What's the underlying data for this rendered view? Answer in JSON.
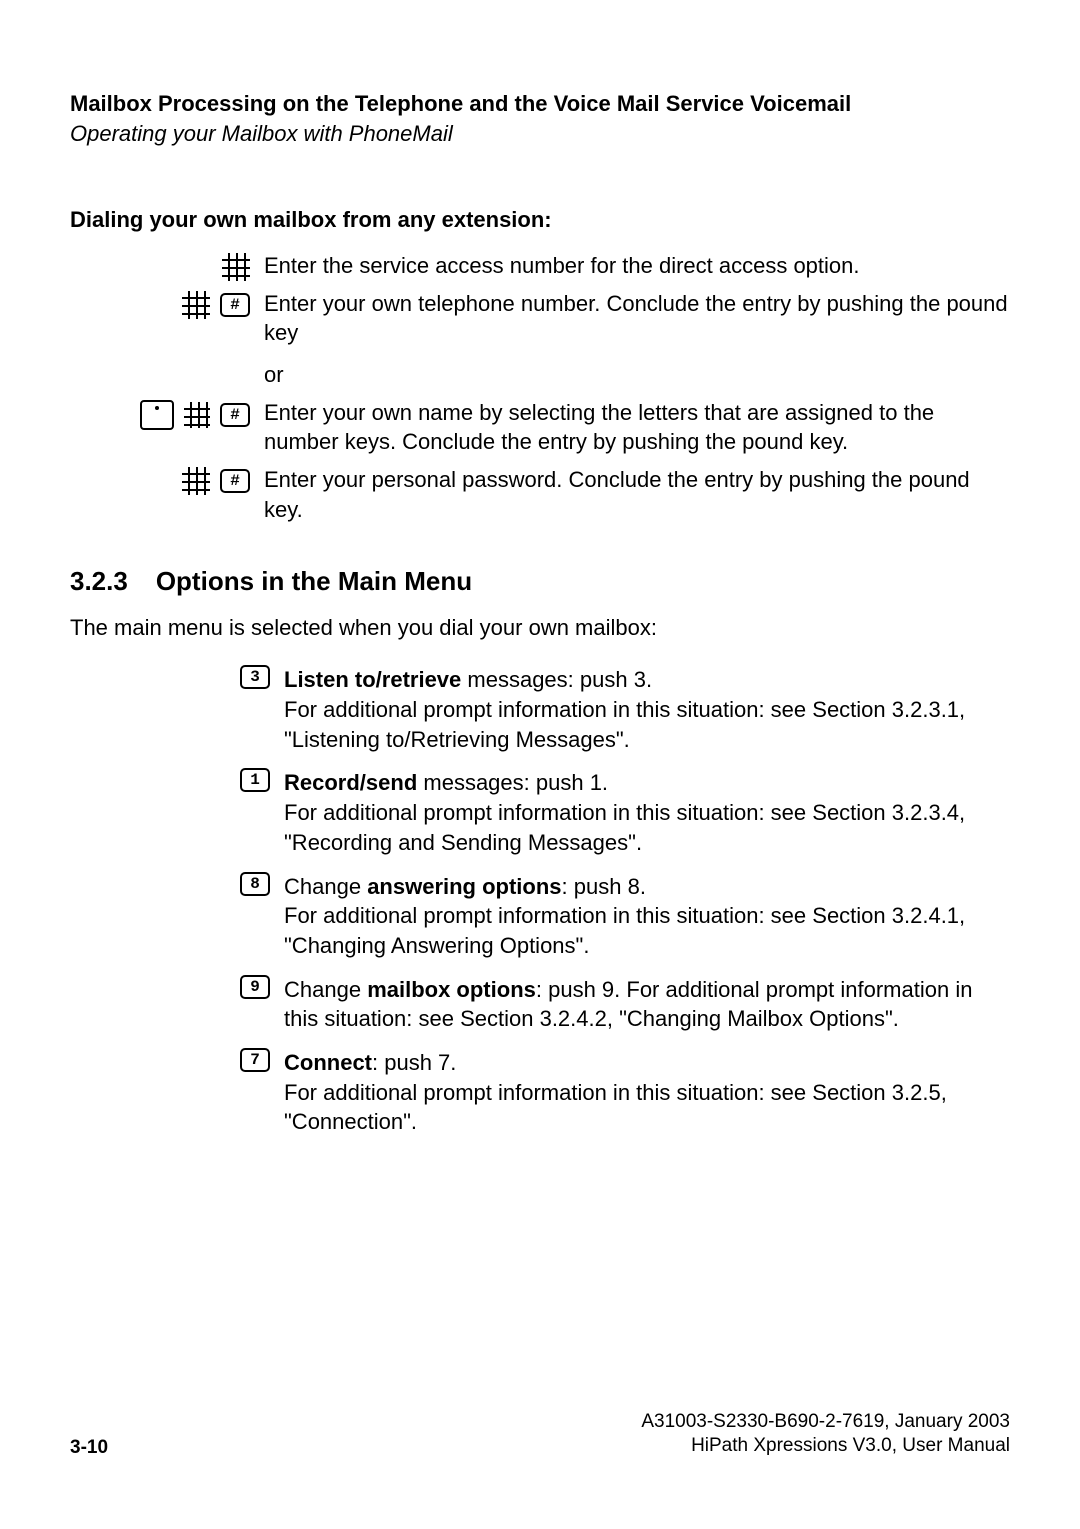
{
  "header": {
    "title": "Mailbox Processing on the Telephone and the Voice Mail Service Voicemail",
    "subtitle": "Operating your Mailbox with PhoneMail"
  },
  "dialing": {
    "heading": "Dialing your own mailbox from any extension:",
    "step1": "Enter the service access number for the direct access option.",
    "step2": "Enter your own telephone number. Conclude the entry by pushing the pound key",
    "or": "or",
    "step3": "Enter your own name by selecting the letters that are assigned to the number keys. Conclude the entry by pushing the pound key.",
    "step4": "Enter your personal password. Conclude the entry by pushing the pound key."
  },
  "section": {
    "number": "3.2.3",
    "title": "Options in the Main Menu",
    "intro": "The main menu is selected when you dial your own mailbox:"
  },
  "options": {
    "o3": {
      "key": "3",
      "b": "Listen to/retrieve",
      "rest": " messages: push 3.",
      "line2": "For additional prompt information in this situation: see Section 3.2.3.1, \"Listening to/Retrieving Messages\"."
    },
    "o1": {
      "key": "1",
      "b": "Record/send",
      "rest": " messages: push 1.",
      "line2": "For additional prompt information in this situation: see Section 3.2.3.4, \"Recording and Sending Messages\"."
    },
    "o8": {
      "key": "8",
      "pre": "Change ",
      "b": "answering options",
      "rest": ": push 8.",
      "line2": "For additional prompt information in this situation: see Section 3.2.4.1, \"Changing Answering Options\"."
    },
    "o9": {
      "key": "9",
      "pre": "Change ",
      "b": "mailbox options",
      "rest": ": push 9. For additional prompt information in this situation: see Section 3.2.4.2, \"Changing Mailbox Options\"."
    },
    "o7": {
      "key": "7",
      "b": "Connect",
      "rest": ": push 7.",
      "line2": "For additional prompt information in this situation: see Section 3.2.5, \"Connection\"."
    }
  },
  "footer": {
    "page": "3-10",
    "doc": "A31003-S2330-B690-2-7619, January 2003",
    "product": "HiPath Xpressions V3.0, User Manual"
  },
  "glyph": {
    "pound": "#"
  }
}
